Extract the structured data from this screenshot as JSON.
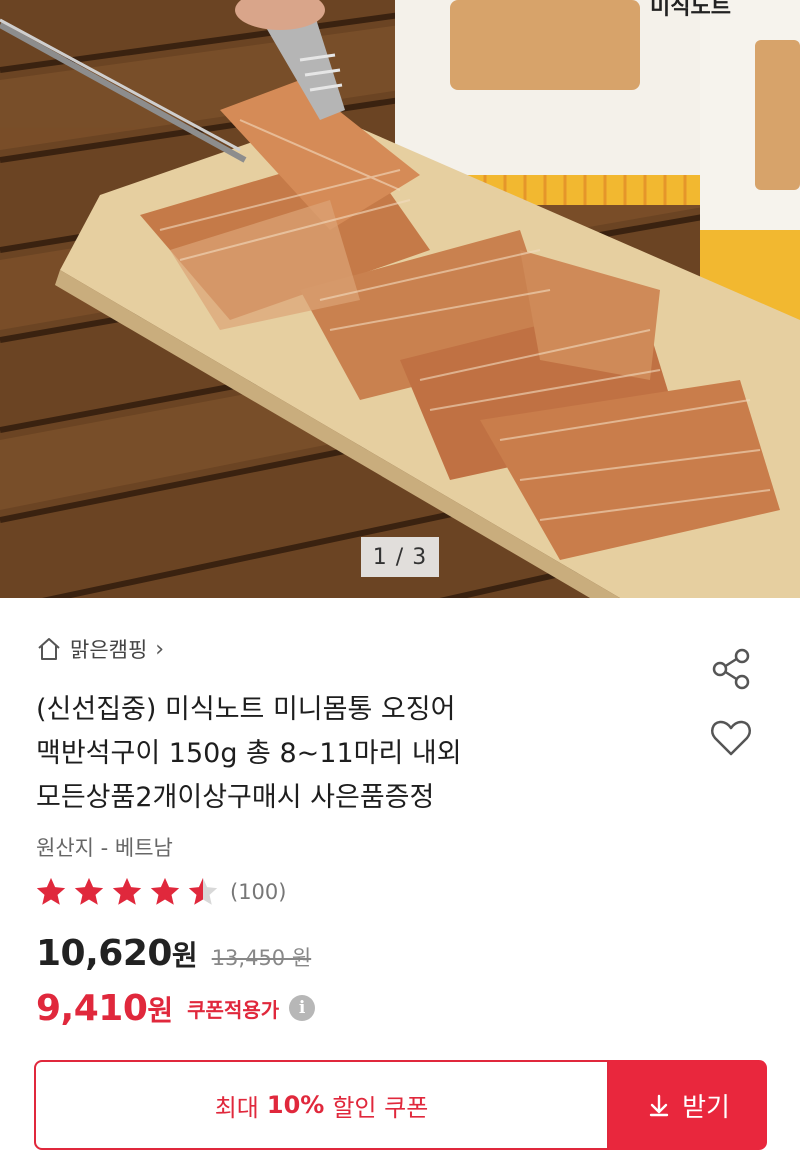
{
  "hero": {
    "pager": "1 / 3",
    "package_text": "미식노트"
  },
  "store": {
    "name": "맑은캠핑",
    "chevron": "›"
  },
  "product": {
    "title_lines": [
      "(신선집중) 미식노트 미니몸통 오징어",
      "맥반석구이 150g 총 8~11마리 내외",
      "모든상품2개이상구매시 사은품증정"
    ],
    "origin": "원산지 - 베트남",
    "rating": {
      "stars": 4.5,
      "max": 5,
      "count": "(100)"
    }
  },
  "price": {
    "current": "10,620",
    "won": "원",
    "original": "13,450 원"
  },
  "coupon": {
    "price": "9,410",
    "won": "원",
    "label": "쿠폰적용가",
    "info_icon": "i",
    "box_prefix": "최대",
    "box_percent": "10%",
    "box_suffix": "할인 쿠폰",
    "get_label": "받기"
  },
  "colors": {
    "accent": "#e0283c",
    "star": "#e0283c",
    "star_empty": "#d8d8d8"
  },
  "icons": {
    "home": "home-icon",
    "share": "share-icon",
    "heart": "heart-icon",
    "download": "download-icon",
    "info": "info-icon"
  }
}
